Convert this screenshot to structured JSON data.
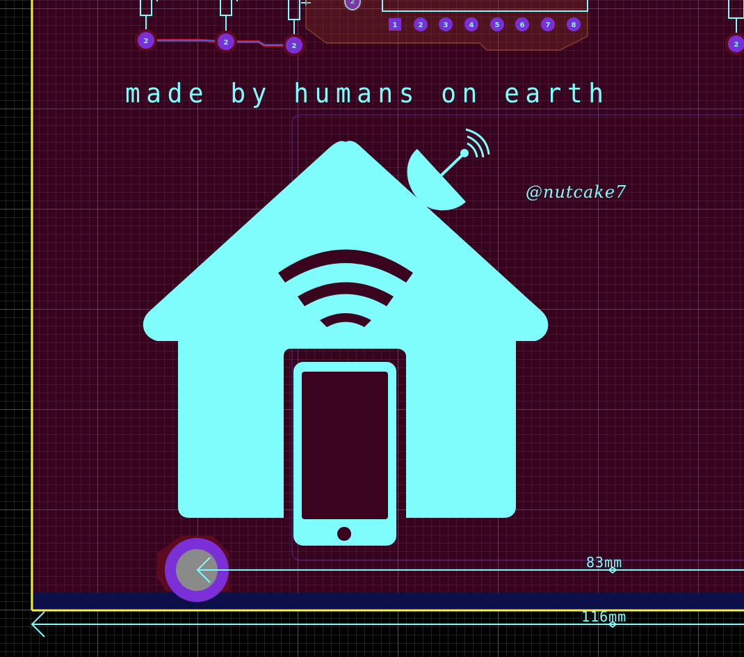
{
  "silkscreen": {
    "tagline": "made by humans on earth",
    "handle": "@nutcake7"
  },
  "dimensions": {
    "inner_label": "83mm",
    "outer_label": "116mm"
  },
  "components": {
    "resistor_pads": [
      "2",
      "2",
      "2"
    ],
    "header_pins": [
      "1",
      "2",
      "3",
      "4",
      "5",
      "6",
      "7",
      "8"
    ],
    "top_via_label": "2",
    "right_pad_label": "2"
  },
  "colors": {
    "board": "#3a041e",
    "silkscreen": "#7ffcfc",
    "pad": "#7b2fd6",
    "board_edge": "#f5f03c"
  },
  "icons": [
    "house-wifi-logo",
    "satellite-dish-icon",
    "smartphone-icon",
    "mounting-hole"
  ]
}
